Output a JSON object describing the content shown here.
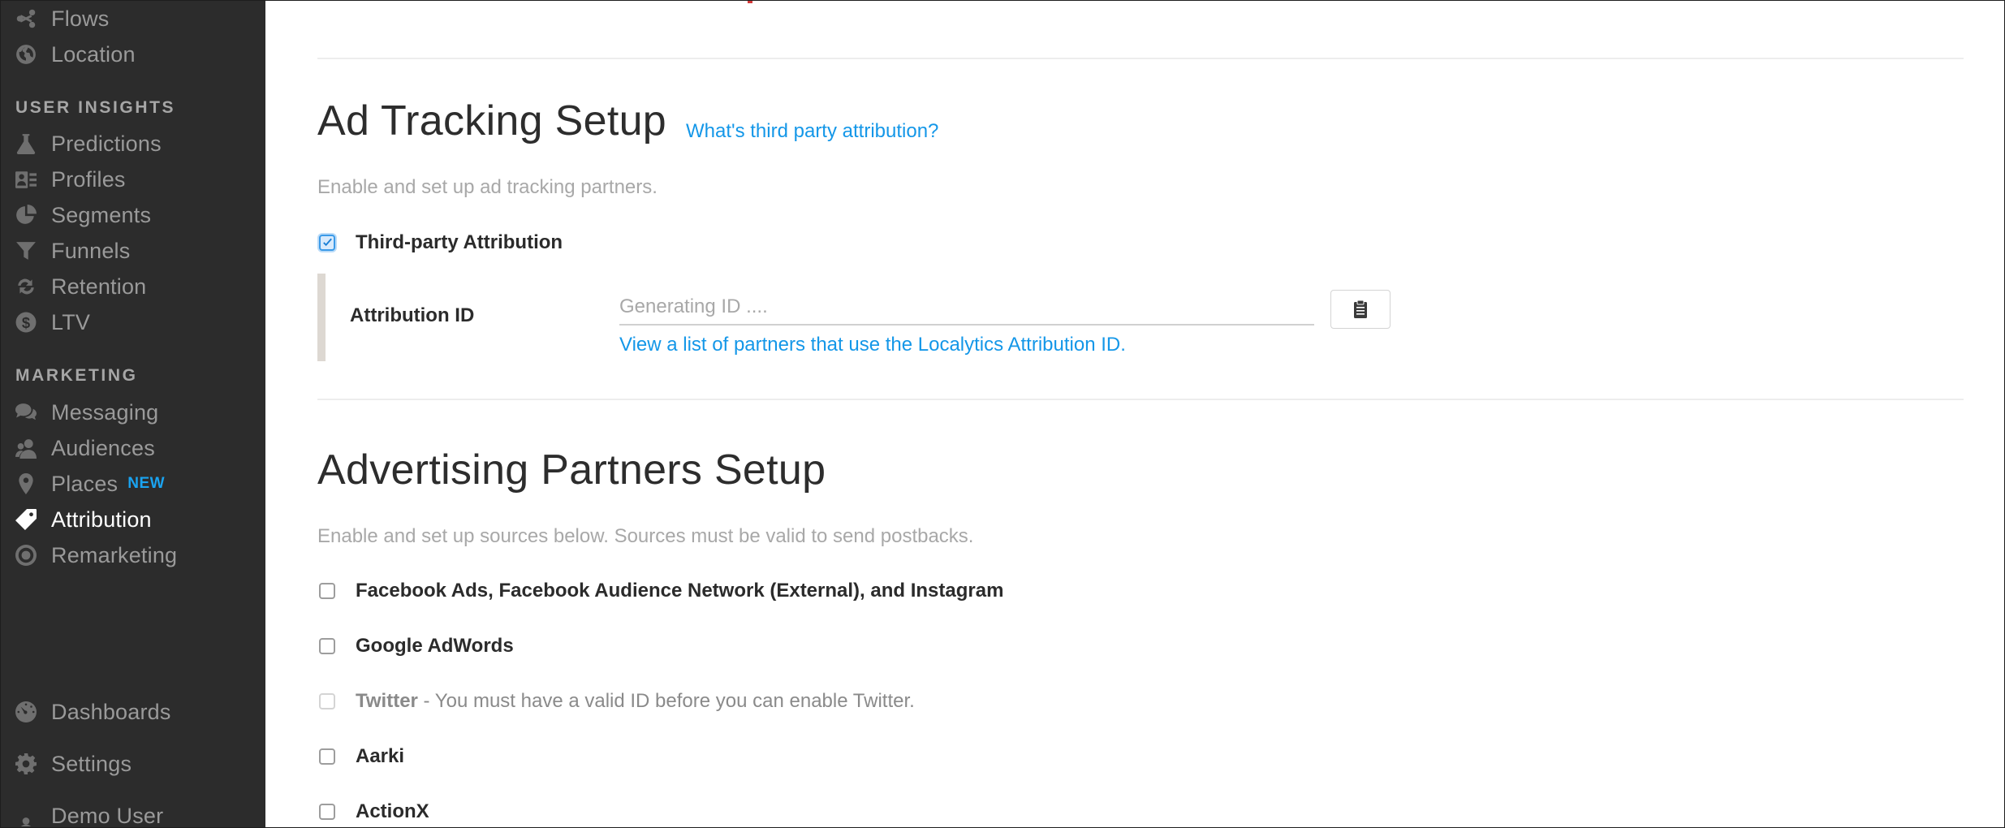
{
  "sidebar": {
    "items_top": [
      {
        "label": "Flows",
        "icon": "share-icon"
      },
      {
        "label": "Location",
        "icon": "globe-icon"
      }
    ],
    "user_insights_header": "USER INSIGHTS",
    "user_insights": [
      {
        "label": "Predictions",
        "icon": "flask-icon"
      },
      {
        "label": "Profiles",
        "icon": "profile-card-icon"
      },
      {
        "label": "Segments",
        "icon": "pie-chart-icon"
      },
      {
        "label": "Funnels",
        "icon": "funnel-icon"
      },
      {
        "label": "Retention",
        "icon": "retention-arrows-icon"
      },
      {
        "label": "LTV",
        "icon": "dollar-circle-icon"
      }
    ],
    "marketing_header": "MARKETING",
    "marketing": [
      {
        "label": "Messaging",
        "icon": "chat-bubbles-icon"
      },
      {
        "label": "Audiences",
        "icon": "users-icon"
      },
      {
        "label": "Places",
        "icon": "map-pin-icon",
        "badge": "NEW"
      },
      {
        "label": "Attribution",
        "icon": "tag-icon",
        "active": true
      },
      {
        "label": "Remarketing",
        "icon": "target-icon"
      }
    ],
    "bottom": [
      {
        "label": "Dashboards",
        "icon": "dashboard-gauge-icon"
      },
      {
        "label": "Settings",
        "icon": "gear-icon"
      },
      {
        "label": "Demo User",
        "icon": "user-icon"
      }
    ]
  },
  "ad_tracking": {
    "title": "Ad Tracking Setup",
    "help_link": "What's third party attribution?",
    "subtitle": "Enable and set up ad tracking partners.",
    "third_party_label": "Third-party Attribution",
    "third_party_checked": true,
    "attribution_id_label": "Attribution ID",
    "attribution_id_placeholder": "Generating ID ....",
    "attribution_id_value": "",
    "partners_link": "View a list of partners that use the Localytics Attribution ID."
  },
  "advertising": {
    "title": "Advertising Partners Setup",
    "subtitle": "Enable and set up sources below. Sources must be valid to send postbacks.",
    "partners": [
      {
        "name": "Facebook Ads, Facebook Audience Network (External), and Instagram",
        "checked": false,
        "disabled": false,
        "note": ""
      },
      {
        "name": "Google AdWords",
        "checked": false,
        "disabled": false,
        "note": ""
      },
      {
        "name": "Twitter",
        "checked": false,
        "disabled": true,
        "note": " - You must have a valid ID before you can enable Twitter."
      },
      {
        "name": "Aarki",
        "checked": false,
        "disabled": false,
        "note": ""
      },
      {
        "name": "ActionX",
        "checked": false,
        "disabled": false,
        "note": ""
      }
    ]
  },
  "colors": {
    "sidebar_bg": "#2c2c2c",
    "link": "#1497e8",
    "badge": "#1aa3f0",
    "checkbox_checked": "#3b9ae8"
  }
}
